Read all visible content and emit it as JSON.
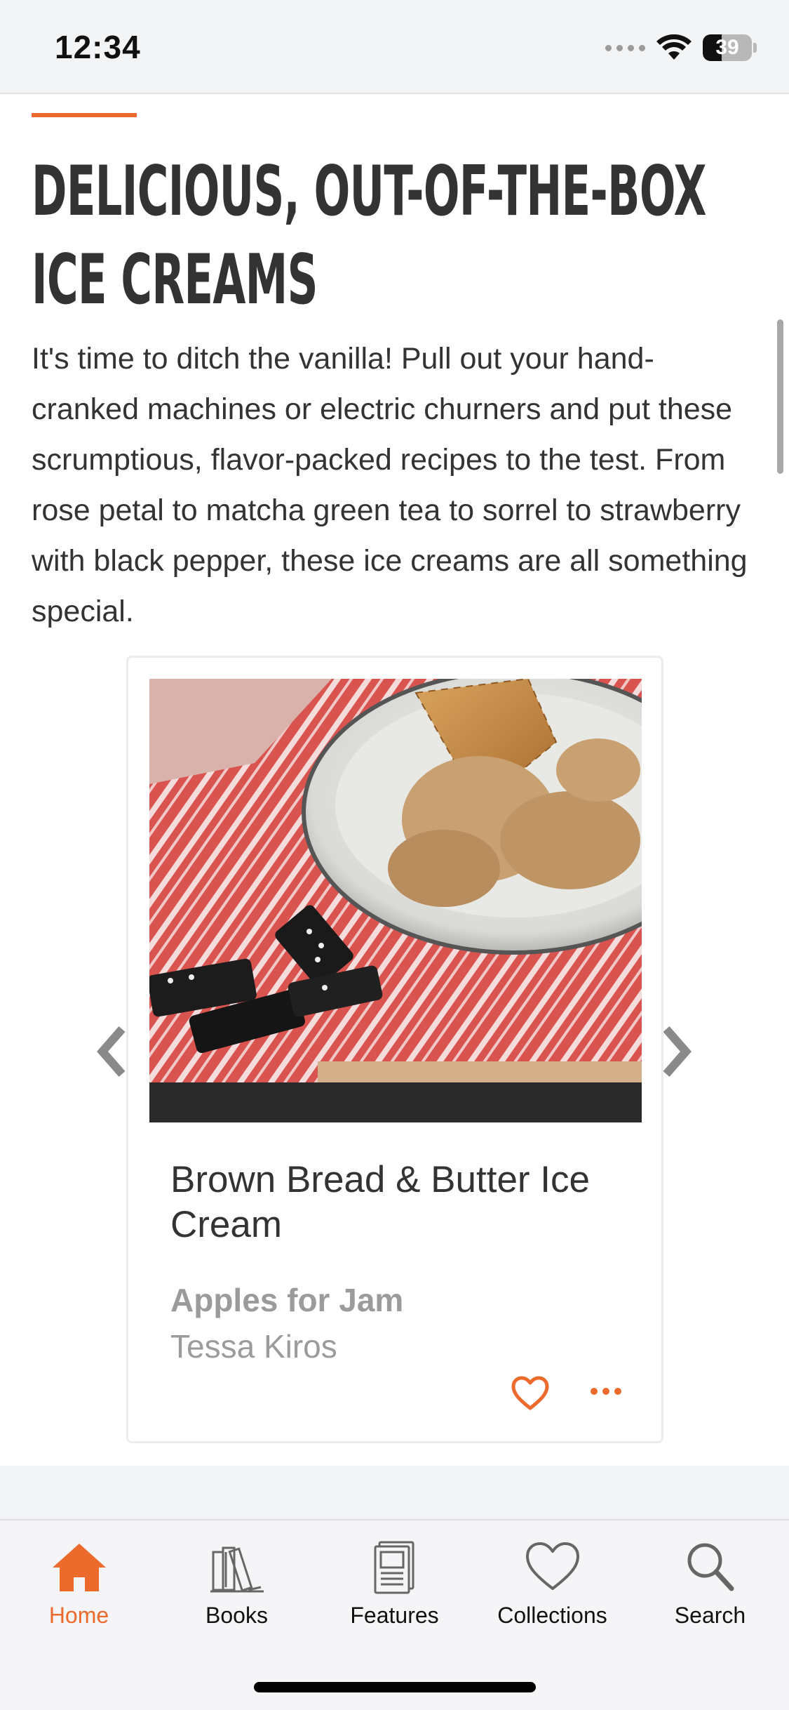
{
  "status_bar": {
    "time": "12:34",
    "battery_percent": "39",
    "battery_level": 0.39,
    "icons": [
      "signal-icon",
      "wifi-icon",
      "battery-icon"
    ]
  },
  "article": {
    "accent_color": "#ec6a2c",
    "headline": "Delicious, Out-of-the-Box Ice Creams",
    "intro": "It's time to ditch the vanilla! Pull out your hand-cranked machines or electric churners and put these scrumptious, flavor-packed recipes to the test. From rose petal to matcha green tea to sorrel to strawberry with black pepper, these ice creams are all something special."
  },
  "carousel": {
    "card": {
      "title": "Brown Bread & Butter Ice Cream",
      "book": "Apples for Jam",
      "author": "Tessa Kiros",
      "favorite_icon": "heart-outline-icon",
      "more_icon": "ellipsis-icon"
    },
    "prev_icon": "chevron-left-icon",
    "next_icon": "chevron-right-icon"
  },
  "tab_bar": {
    "tabs": [
      {
        "label": "Home",
        "icon": "home-icon",
        "active": true
      },
      {
        "label": "Books",
        "icon": "books-icon",
        "active": false
      },
      {
        "label": "Features",
        "icon": "features-icon",
        "active": false
      },
      {
        "label": "Collections",
        "icon": "heart-icon",
        "active": false
      },
      {
        "label": "Search",
        "icon": "search-icon",
        "active": false
      }
    ],
    "active_color": "#ec6a2c"
  }
}
